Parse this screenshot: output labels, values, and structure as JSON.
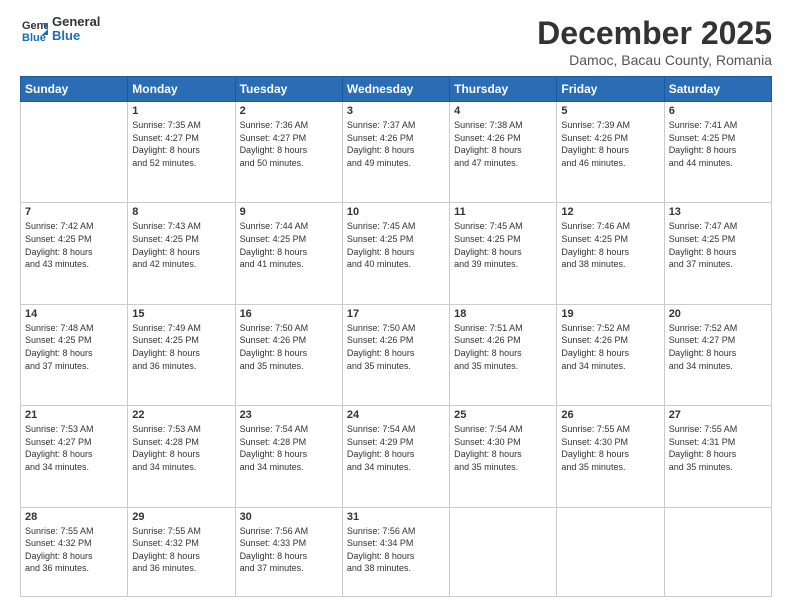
{
  "header": {
    "logo_line1": "General",
    "logo_line2": "Blue",
    "title": "December 2025",
    "location": "Damoc, Bacau County, Romania"
  },
  "weekdays": [
    "Sunday",
    "Monday",
    "Tuesday",
    "Wednesday",
    "Thursday",
    "Friday",
    "Saturday"
  ],
  "weeks": [
    [
      {
        "day": "",
        "text": ""
      },
      {
        "day": "1",
        "text": "Sunrise: 7:35 AM\nSunset: 4:27 PM\nDaylight: 8 hours\nand 52 minutes."
      },
      {
        "day": "2",
        "text": "Sunrise: 7:36 AM\nSunset: 4:27 PM\nDaylight: 8 hours\nand 50 minutes."
      },
      {
        "day": "3",
        "text": "Sunrise: 7:37 AM\nSunset: 4:26 PM\nDaylight: 8 hours\nand 49 minutes."
      },
      {
        "day": "4",
        "text": "Sunrise: 7:38 AM\nSunset: 4:26 PM\nDaylight: 8 hours\nand 47 minutes."
      },
      {
        "day": "5",
        "text": "Sunrise: 7:39 AM\nSunset: 4:26 PM\nDaylight: 8 hours\nand 46 minutes."
      },
      {
        "day": "6",
        "text": "Sunrise: 7:41 AM\nSunset: 4:25 PM\nDaylight: 8 hours\nand 44 minutes."
      }
    ],
    [
      {
        "day": "7",
        "text": "Sunrise: 7:42 AM\nSunset: 4:25 PM\nDaylight: 8 hours\nand 43 minutes."
      },
      {
        "day": "8",
        "text": "Sunrise: 7:43 AM\nSunset: 4:25 PM\nDaylight: 8 hours\nand 42 minutes."
      },
      {
        "day": "9",
        "text": "Sunrise: 7:44 AM\nSunset: 4:25 PM\nDaylight: 8 hours\nand 41 minutes."
      },
      {
        "day": "10",
        "text": "Sunrise: 7:45 AM\nSunset: 4:25 PM\nDaylight: 8 hours\nand 40 minutes."
      },
      {
        "day": "11",
        "text": "Sunrise: 7:45 AM\nSunset: 4:25 PM\nDaylight: 8 hours\nand 39 minutes."
      },
      {
        "day": "12",
        "text": "Sunrise: 7:46 AM\nSunset: 4:25 PM\nDaylight: 8 hours\nand 38 minutes."
      },
      {
        "day": "13",
        "text": "Sunrise: 7:47 AM\nSunset: 4:25 PM\nDaylight: 8 hours\nand 37 minutes."
      }
    ],
    [
      {
        "day": "14",
        "text": "Sunrise: 7:48 AM\nSunset: 4:25 PM\nDaylight: 8 hours\nand 37 minutes."
      },
      {
        "day": "15",
        "text": "Sunrise: 7:49 AM\nSunset: 4:25 PM\nDaylight: 8 hours\nand 36 minutes."
      },
      {
        "day": "16",
        "text": "Sunrise: 7:50 AM\nSunset: 4:26 PM\nDaylight: 8 hours\nand 35 minutes."
      },
      {
        "day": "17",
        "text": "Sunrise: 7:50 AM\nSunset: 4:26 PM\nDaylight: 8 hours\nand 35 minutes."
      },
      {
        "day": "18",
        "text": "Sunrise: 7:51 AM\nSunset: 4:26 PM\nDaylight: 8 hours\nand 35 minutes."
      },
      {
        "day": "19",
        "text": "Sunrise: 7:52 AM\nSunset: 4:26 PM\nDaylight: 8 hours\nand 34 minutes."
      },
      {
        "day": "20",
        "text": "Sunrise: 7:52 AM\nSunset: 4:27 PM\nDaylight: 8 hours\nand 34 minutes."
      }
    ],
    [
      {
        "day": "21",
        "text": "Sunrise: 7:53 AM\nSunset: 4:27 PM\nDaylight: 8 hours\nand 34 minutes."
      },
      {
        "day": "22",
        "text": "Sunrise: 7:53 AM\nSunset: 4:28 PM\nDaylight: 8 hours\nand 34 minutes."
      },
      {
        "day": "23",
        "text": "Sunrise: 7:54 AM\nSunset: 4:28 PM\nDaylight: 8 hours\nand 34 minutes."
      },
      {
        "day": "24",
        "text": "Sunrise: 7:54 AM\nSunset: 4:29 PM\nDaylight: 8 hours\nand 34 minutes."
      },
      {
        "day": "25",
        "text": "Sunrise: 7:54 AM\nSunset: 4:30 PM\nDaylight: 8 hours\nand 35 minutes."
      },
      {
        "day": "26",
        "text": "Sunrise: 7:55 AM\nSunset: 4:30 PM\nDaylight: 8 hours\nand 35 minutes."
      },
      {
        "day": "27",
        "text": "Sunrise: 7:55 AM\nSunset: 4:31 PM\nDaylight: 8 hours\nand 35 minutes."
      }
    ],
    [
      {
        "day": "28",
        "text": "Sunrise: 7:55 AM\nSunset: 4:32 PM\nDaylight: 8 hours\nand 36 minutes."
      },
      {
        "day": "29",
        "text": "Sunrise: 7:55 AM\nSunset: 4:32 PM\nDaylight: 8 hours\nand 36 minutes."
      },
      {
        "day": "30",
        "text": "Sunrise: 7:56 AM\nSunset: 4:33 PM\nDaylight: 8 hours\nand 37 minutes."
      },
      {
        "day": "31",
        "text": "Sunrise: 7:56 AM\nSunset: 4:34 PM\nDaylight: 8 hours\nand 38 minutes."
      },
      {
        "day": "",
        "text": ""
      },
      {
        "day": "",
        "text": ""
      },
      {
        "day": "",
        "text": ""
      }
    ]
  ]
}
